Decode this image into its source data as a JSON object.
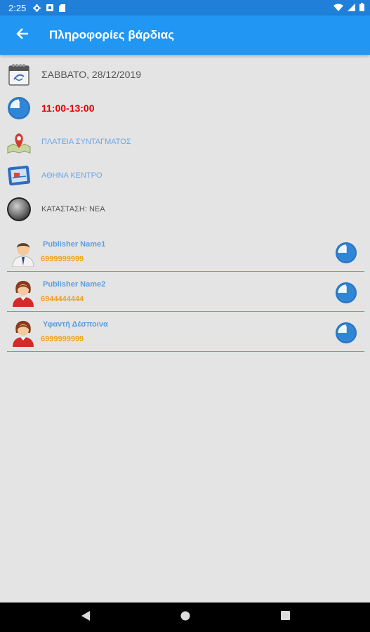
{
  "status_bar": {
    "time": "2:25"
  },
  "app_bar": {
    "title": "Πληροφορίες βάρδιας"
  },
  "shift": {
    "date": "ΣΑΒΒΑΤΟ, 28/12/2019",
    "time": "11:00-13:00",
    "location": "ΠΛΑΤΕΙΑ ΣΥΝΤΑΓΜΑΤΟΣ",
    "area": "ΑΘΗΝΑ ΚΕΝΤΡΟ",
    "state": "ΚΑΤΑΣΤΑΣΗ: ΝΕΑ"
  },
  "publishers": [
    {
      "name": "Publisher Name1",
      "phone": "6999999999",
      "avatar": "male-avatar"
    },
    {
      "name": "Publisher Name2",
      "phone": "6944444444",
      "avatar": "female-avatar"
    },
    {
      "name": "Υφαντή Δέσποινα",
      "phone": "6999999999",
      "avatar": "female-avatar"
    }
  ],
  "colors": {
    "primary": "#2196f3",
    "status_bar": "#1f7fd9",
    "time_red": "#e00000",
    "phone_orange": "#f0a020",
    "divider": "#e07070"
  }
}
